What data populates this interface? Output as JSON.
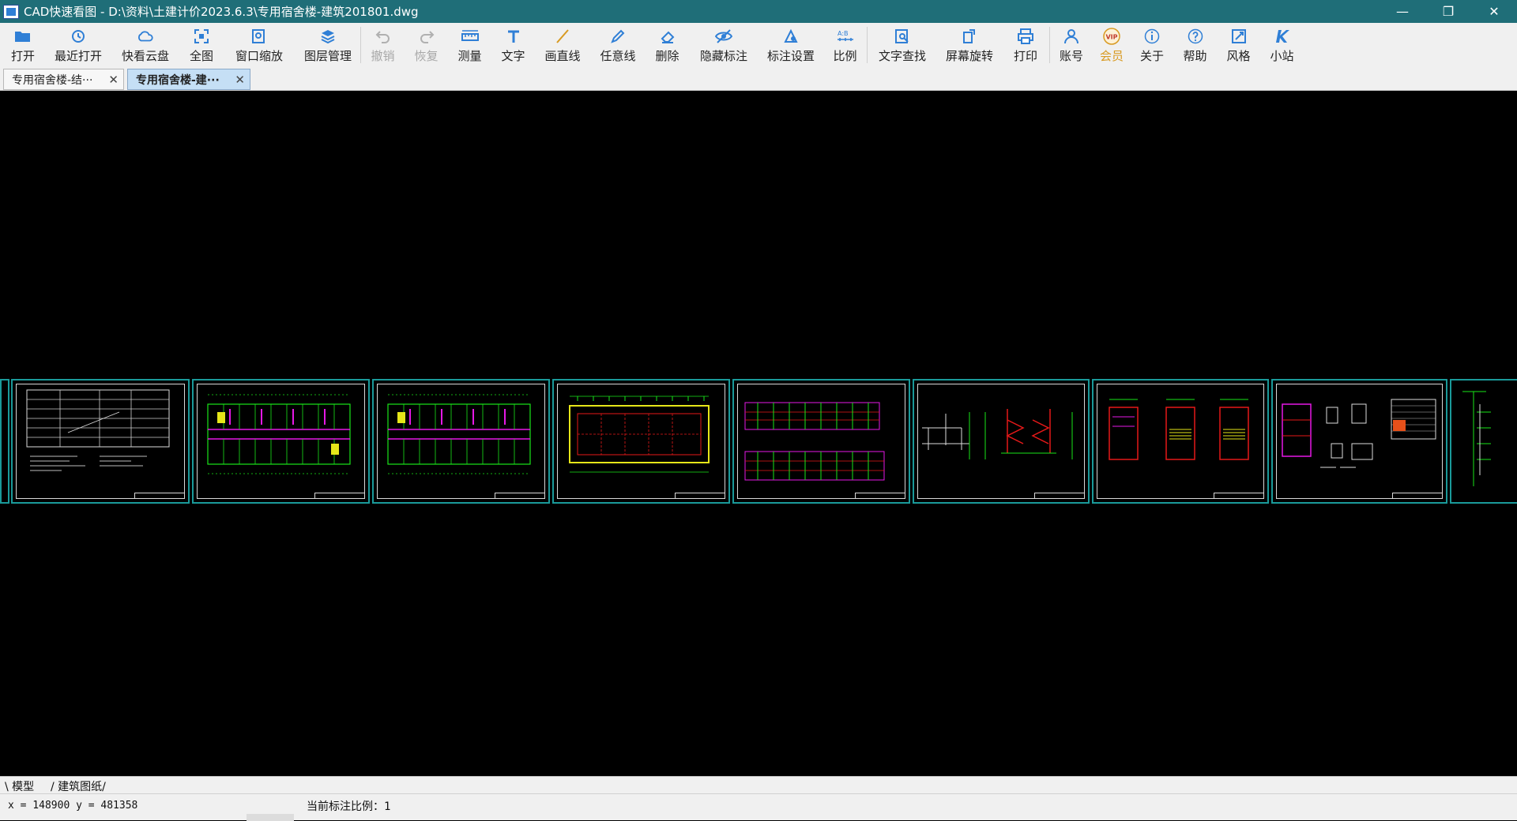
{
  "window": {
    "title": "CAD快速看图 - D:\\资料\\土建计价2023.6.3\\专用宿舍楼-建筑201801.dwg"
  },
  "toolbar": {
    "items": [
      {
        "label": "打开",
        "icon": "folder-open-icon"
      },
      {
        "label": "最近打开",
        "icon": "history-icon"
      },
      {
        "label": "快看云盘",
        "icon": "cloud-icon"
      },
      {
        "label": "全图",
        "icon": "fit-all-icon"
      },
      {
        "label": "窗口缩放",
        "icon": "zoom-window-icon"
      },
      {
        "label": "图层管理",
        "icon": "layers-icon"
      },
      {
        "label": "撤销",
        "icon": "undo-icon"
      },
      {
        "label": "恢复",
        "icon": "redo-icon"
      },
      {
        "label": "测量",
        "icon": "ruler-icon"
      },
      {
        "label": "文字",
        "icon": "text-icon"
      },
      {
        "label": "画直线",
        "icon": "line-icon"
      },
      {
        "label": "任意线",
        "icon": "pen-icon"
      },
      {
        "label": "删除",
        "icon": "eraser-icon"
      },
      {
        "label": "隐藏标注",
        "icon": "eye-hide-icon"
      },
      {
        "label": "标注设置",
        "icon": "dimension-settings-icon"
      },
      {
        "label": "比例",
        "icon": "scale-icon"
      },
      {
        "label": "文字查找",
        "icon": "text-search-icon"
      },
      {
        "label": "屏幕旋转",
        "icon": "rotate-screen-icon"
      },
      {
        "label": "打印",
        "icon": "printer-icon"
      },
      {
        "label": "账号",
        "icon": "user-icon"
      },
      {
        "label": "会员",
        "icon": "vip-icon",
        "badge": "VIP"
      },
      {
        "label": "关于",
        "icon": "info-icon"
      },
      {
        "label": "帮助",
        "icon": "help-icon"
      },
      {
        "label": "风格",
        "icon": "style-icon"
      },
      {
        "label": "小站",
        "icon": "site-icon"
      }
    ]
  },
  "tabs": [
    {
      "label": "专用宿舍楼-结···",
      "active": false
    },
    {
      "label": "专用宿舍楼-建···",
      "active": true
    }
  ],
  "layout_tabs": [
    "模型",
    "建筑图纸"
  ],
  "status": {
    "coords": "x = 148900 y = 481358",
    "scale_label": "当前标注比例：1"
  },
  "colors": {
    "titlebar": "#1f6e78",
    "toolbar_icon": "#2f7fd6",
    "vip": "#d89a22",
    "sheet_border": "#1a9a9a",
    "drawing_green": "#19e619",
    "drawing_magenta": "#e619e6",
    "drawing_red": "#e61919",
    "drawing_yellow": "#e6e619"
  }
}
